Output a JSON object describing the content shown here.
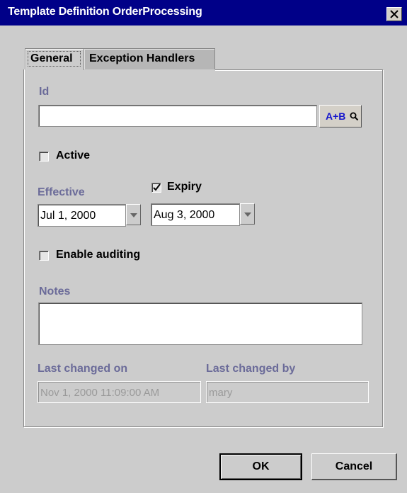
{
  "window": {
    "title": "Template Definition OrderProcessing"
  },
  "tabs": [
    {
      "label": "General",
      "selected": true
    },
    {
      "label": "Exception Handlers",
      "selected": false
    }
  ],
  "form": {
    "id_label": "Id",
    "id_value": "",
    "lookup_label": "A+B",
    "active": {
      "label": "Active",
      "checked": false
    },
    "effective": {
      "label": "Effective",
      "value": "Jul 1, 2000"
    },
    "expiry": {
      "label": "Expiry",
      "checked": true,
      "value": "Aug 3, 2000"
    },
    "auditing": {
      "label": "Enable auditing",
      "checked": false
    },
    "notes": {
      "label": "Notes",
      "value": ""
    },
    "last_changed_on": {
      "label": "Last changed on",
      "value": "Nov 1, 2000 11:09:00 AM"
    },
    "last_changed_by": {
      "label": "Last changed by",
      "value": "mary"
    }
  },
  "buttons": {
    "ok": "OK",
    "cancel": "Cancel"
  },
  "colors": {
    "titlebar": "#000088",
    "dialog_bg": "#cccccc",
    "label": "#6b6b99",
    "lookup_text": "#1515cc"
  }
}
